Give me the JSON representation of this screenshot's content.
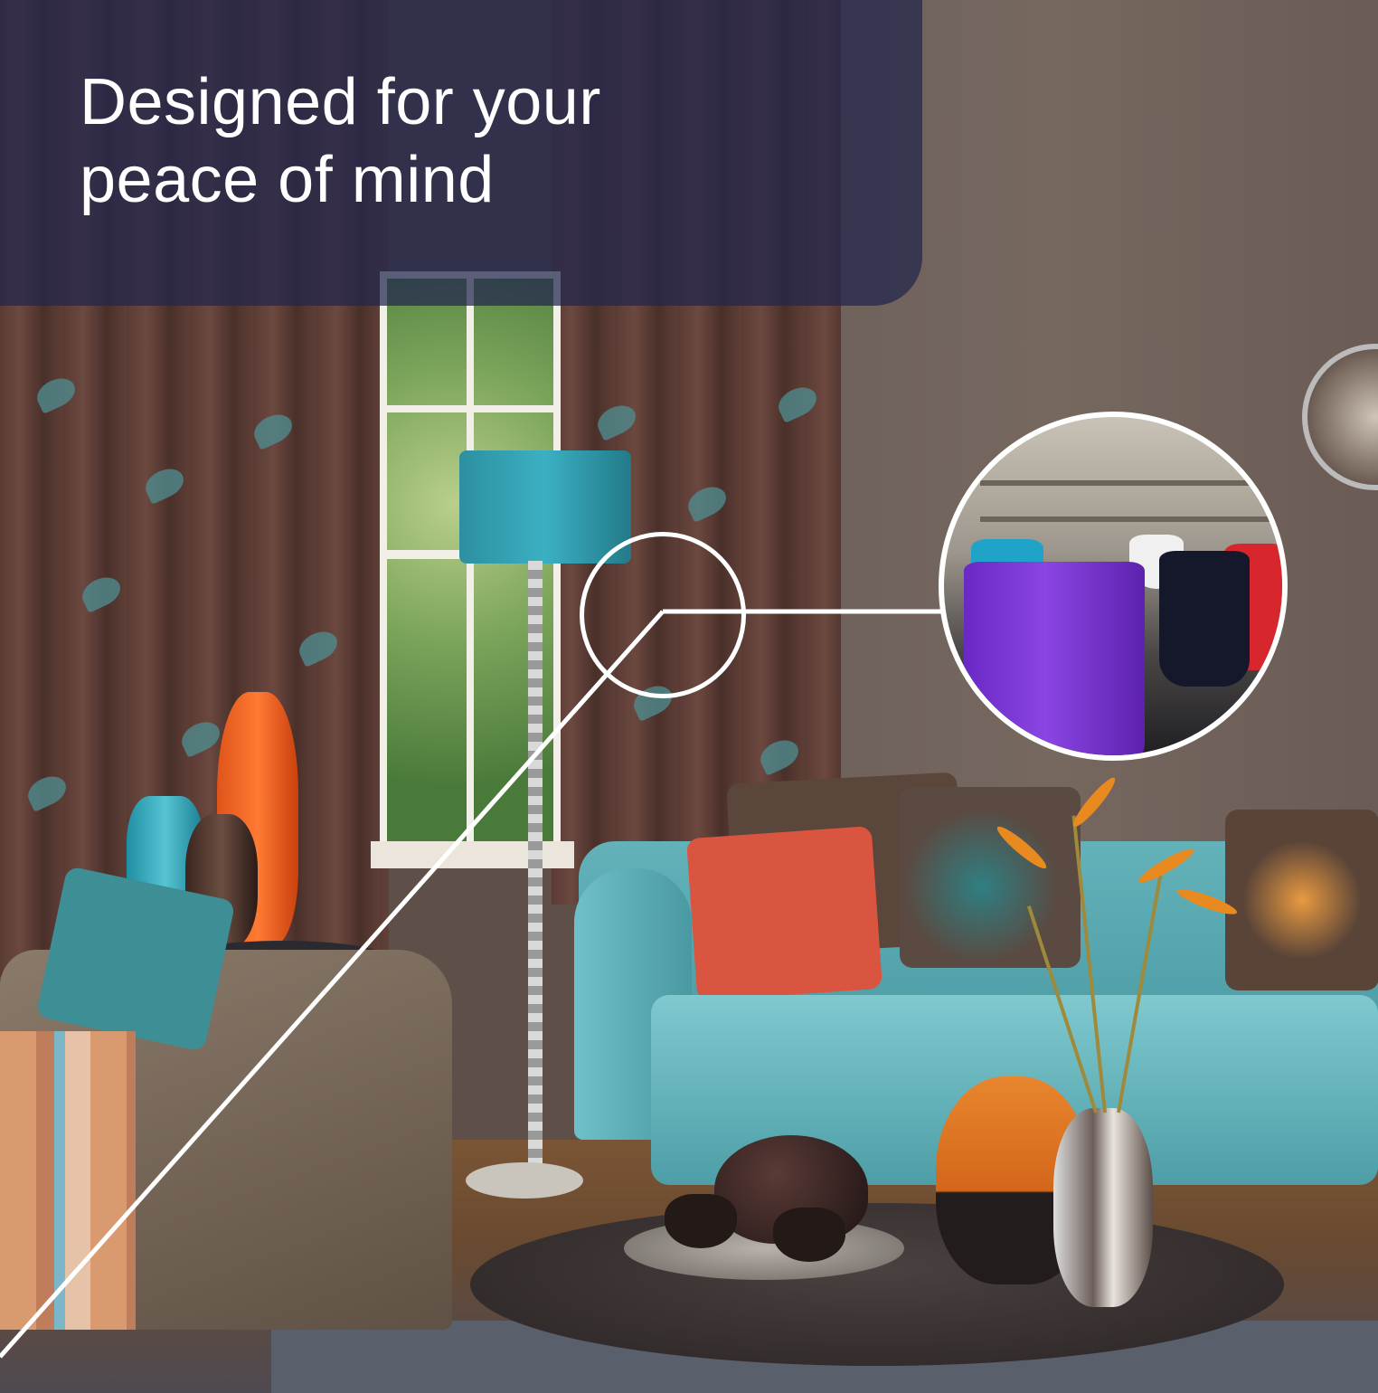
{
  "headline": {
    "line1": "Designed for your",
    "line2": "peace of mind"
  },
  "colors": {
    "banner": "#21264e",
    "headline_text": "#ffffff",
    "callout_line": "#ffffff",
    "sofa": "#5fb0b8",
    "curtain": "#5a3b34",
    "accent_orange": "#e2621e",
    "yarn_purple": "#7a2fd0"
  }
}
